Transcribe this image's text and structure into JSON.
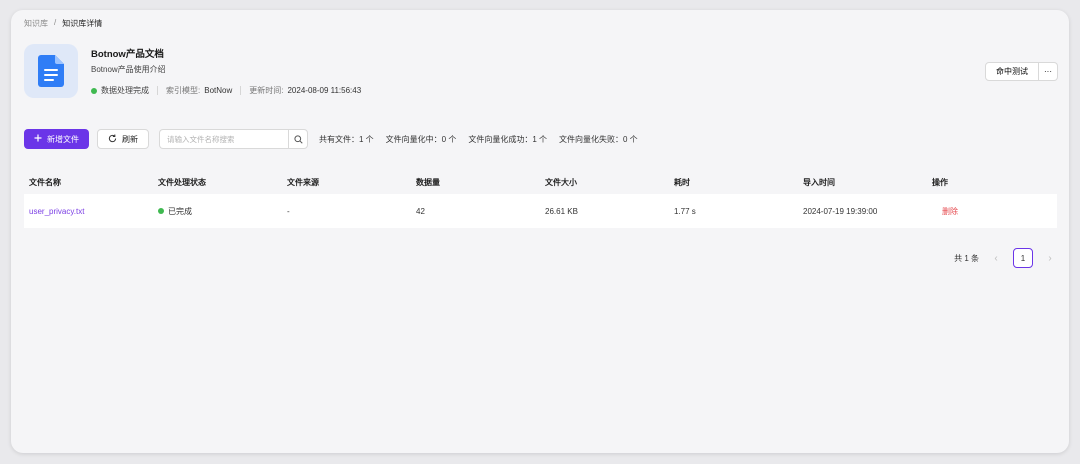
{
  "breadcrumb": {
    "root": "知识库",
    "separator": "/",
    "current": "知识库详情"
  },
  "kb": {
    "icon": "document-icon",
    "title": "Botnow产品文档",
    "description": "Botnow产品使用介绍",
    "status": "数据处理完成",
    "index_model_label": "索引模型:",
    "index_model": "BotNow",
    "updated_label": "更新时间:",
    "updated_at": "2024-08-09 11:56:43"
  },
  "actions": {
    "hit_test": "命中测试",
    "more": "···"
  },
  "toolbar": {
    "new_file": "新增文件",
    "refresh": "刷新",
    "search_placeholder": "请输入文件名称搜索",
    "stats": [
      "共有文件：1 个",
      "文件向量化中：0 个",
      "文件向量化成功：1 个",
      "文件向量化失败：0 个"
    ]
  },
  "table": {
    "columns": [
      "文件名称",
      "文件处理状态",
      "文件来源",
      "数据量",
      "文件大小",
      "耗时",
      "导入时间",
      "操作"
    ],
    "rows": [
      {
        "name": "user_privacy.txt",
        "status": "已完成",
        "source": "-",
        "count": "42",
        "size": "26.61 KB",
        "duration": "1.77 s",
        "imported_at": "2024-07-19 19:39:00",
        "action": "删除"
      }
    ]
  },
  "pagination": {
    "total": "共 1 条",
    "current": "1",
    "prev": "‹",
    "next": "›"
  },
  "colors": {
    "accent": "#6b35e8",
    "success": "#3fb950",
    "danger": "#e5484d",
    "link": "#7b3fe4"
  }
}
